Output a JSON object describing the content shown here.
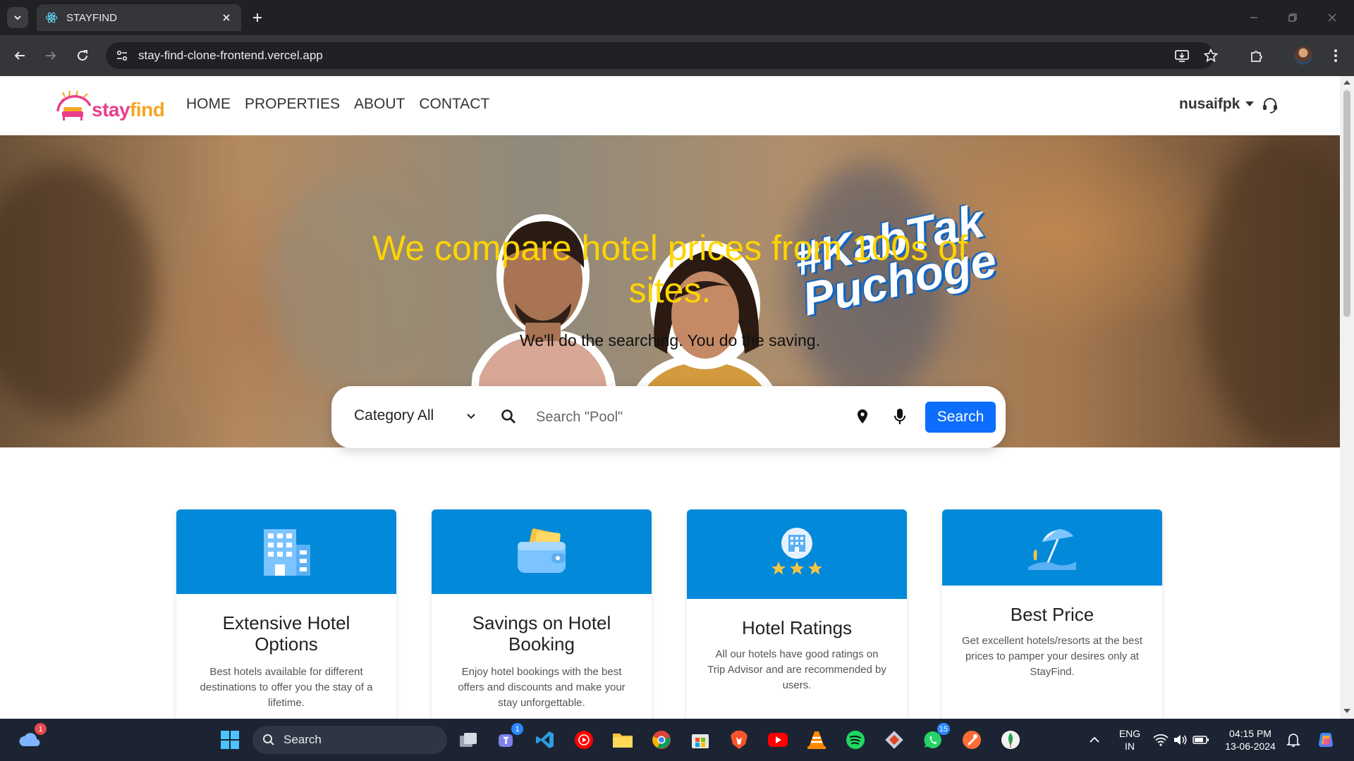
{
  "browser": {
    "tab_title": "STAYFIND",
    "url": "stay-find-clone-frontend.vercel.app"
  },
  "site": {
    "logo": {
      "part1": "stay",
      "part2": "find"
    },
    "nav": [
      "HOME",
      "PROPERTIES",
      "ABOUT",
      "CONTACT"
    ],
    "user_name": "nusaifpk"
  },
  "hero": {
    "title": "We compare hotel prices from 100s of sites.",
    "subtitle": "We'll do the searching. You do the saving.",
    "overlay_hashtag_line1": "#KabTak",
    "overlay_hashtag_line2": "Puchoge"
  },
  "search": {
    "category_label": "Category All",
    "placeholder": "Search \"Pool\"",
    "button_label": "Search"
  },
  "features": [
    {
      "title": "Extensive Hotel Options",
      "text": "Best hotels available for different destinations to offer you the stay of a lifetime.",
      "icon": "building-icon"
    },
    {
      "title": "Savings on Hotel Booking",
      "text": "Enjoy hotel bookings with the best offers and discounts and make your stay unforgettable.",
      "icon": "wallet-icon"
    },
    {
      "title": "Hotel Ratings",
      "text": "All our hotels have good ratings on Trip Advisor and are recommended by users.",
      "icon": "hotel-stars-icon"
    },
    {
      "title": "Best Price",
      "text": "Get excellent hotels/resorts at the best prices to pamper your desires only at StayFind.",
      "icon": "beach-umbrella-icon"
    }
  ],
  "taskbar": {
    "search_label": "Search",
    "weather_badge": "1",
    "teams_badge": "1",
    "whatsapp_badge": "15",
    "lang_line1": "ENG",
    "lang_line2": "IN",
    "time": "04:15 PM",
    "date": "13-06-2024"
  },
  "colors": {
    "accent": "#0d6efd",
    "card_header": "#0289d9",
    "hero_title": "#ffd400"
  }
}
